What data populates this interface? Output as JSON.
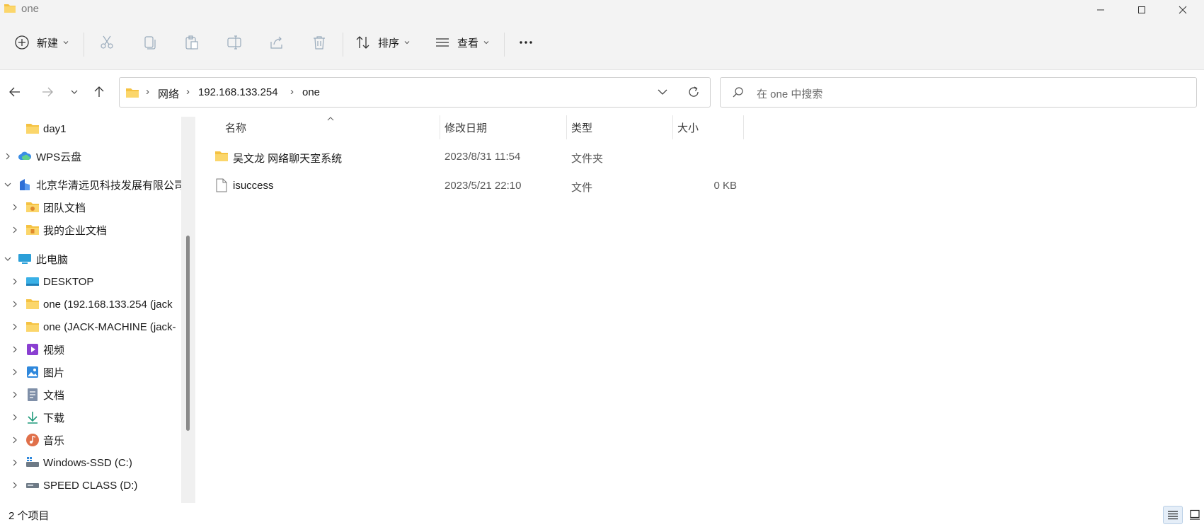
{
  "window": {
    "title": "one",
    "controls": [
      "minimize-icon",
      "maximize-icon",
      "close-icon"
    ]
  },
  "toolbar": {
    "new_label": "新建",
    "sort_label": "排序",
    "view_label": "查看",
    "icons": [
      "cut-icon",
      "copy-icon",
      "paste-icon",
      "rename-icon",
      "share-icon",
      "delete-icon",
      "more-icon"
    ]
  },
  "address": {
    "crumbs": [
      "网络",
      "192.168.133.254",
      "one"
    ]
  },
  "search": {
    "placeholder": "在 one 中搜索"
  },
  "nav": {
    "items": [
      {
        "label": "day1",
        "icon": "folder-icon"
      },
      {
        "label": "WPS云盘",
        "icon": "cloud-icon"
      },
      {
        "label": "北京华清远见科技发展有限公司",
        "icon": "company-icon"
      },
      {
        "label": "团队文档",
        "icon": "team-folder-icon"
      },
      {
        "label": "我的企业文档",
        "icon": "enterprise-folder-icon"
      },
      {
        "label": "此电脑",
        "icon": "computer-icon"
      },
      {
        "label": "DESKTOP",
        "icon": "desktop-icon"
      },
      {
        "label": "one (192.168.133.254 (jack",
        "icon": "network-folder-icon"
      },
      {
        "label": "one (JACK-MACHINE (jack-",
        "icon": "network-folder-icon"
      },
      {
        "label": "视频",
        "icon": "videos-icon"
      },
      {
        "label": "图片",
        "icon": "pictures-icon"
      },
      {
        "label": "文档",
        "icon": "documents-icon"
      },
      {
        "label": "下载",
        "icon": "downloads-icon"
      },
      {
        "label": "音乐",
        "icon": "music-icon"
      },
      {
        "label": "Windows-SSD (C:)",
        "icon": "drive-c-icon"
      },
      {
        "label": "SPEED CLASS (D:)",
        "icon": "drive-d-icon"
      }
    ]
  },
  "columns": {
    "name": "名称",
    "modified": "修改日期",
    "type": "类型",
    "size": "大小"
  },
  "files": [
    {
      "name": "吴文龙 网络聊天室系统",
      "modified": "2023/8/31 11:54",
      "type": "文件夹",
      "size": "",
      "icon": "folder-icon"
    },
    {
      "name": "isuccess",
      "modified": "2023/5/21 22:10",
      "type": "文件",
      "size": "0 KB",
      "icon": "file-icon"
    }
  ],
  "status": {
    "count": "2 个项目"
  },
  "colors": {
    "folder": "#f5c242",
    "accent": "#0067c0",
    "chrome": "#f3f3f3"
  }
}
